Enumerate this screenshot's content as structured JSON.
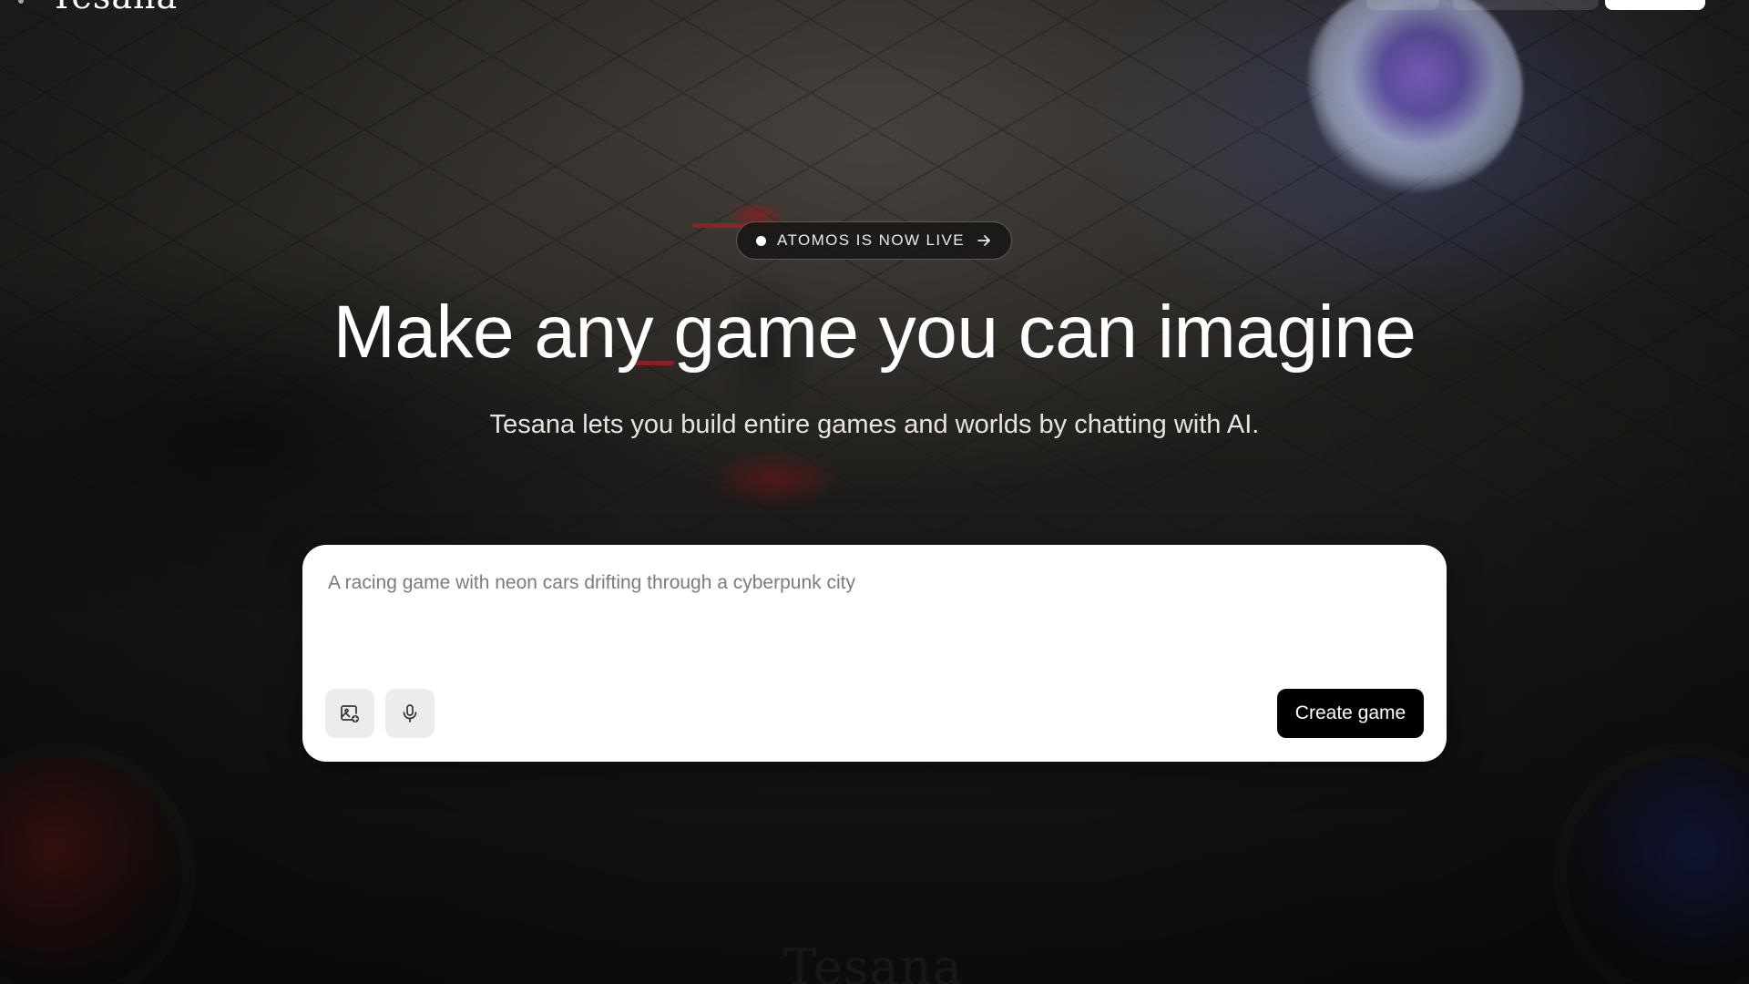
{
  "header": {
    "brand_name": "Tesana"
  },
  "hero": {
    "announcement": {
      "label": "ATOMOS IS NOW LIVE",
      "arrow_icon": "arrow-right-icon"
    },
    "headline": "Make any game you can imagine",
    "subheadline": "Tesana lets you build entire games and worlds by chatting with AI."
  },
  "prompt": {
    "placeholder": "A racing game with neon cars drifting through a cyberpunk city",
    "value": "",
    "tools": [
      {
        "icon": "image-add-icon"
      },
      {
        "icon": "microphone-icon"
      }
    ],
    "submit_label": "Create game"
  },
  "background": {
    "watermark_text": "Tesana"
  },
  "colors": {
    "background": "#1c1a18",
    "text": "#ffffff",
    "card": "#ffffff",
    "tool_button": "#ececec",
    "primary_button": "#000000"
  }
}
